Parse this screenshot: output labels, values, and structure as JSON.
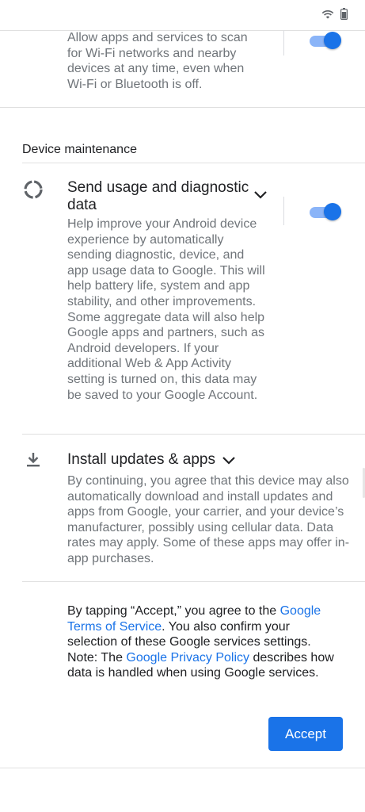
{
  "wifi_scan": {
    "description": "Allow apps and services to scan for Wi-Fi networks and nearby devices at any time, even when Wi-Fi or Bluetooth is off.",
    "toggle_on": true
  },
  "device_maintenance": {
    "header": "Device maintenance",
    "usage": {
      "icon": "progress-circle-icon",
      "title": "Send usage and diagnostic data",
      "description": "Help improve your Android device experience by automatically sending diagnostic, device, and app usage data to Google. This will help battery life, system and app stability, and other improvements. Some aggregate data will also help Google apps and partners, such as Android developers. If your additional Web & App Activity setting is turned on, this data may be saved to your Google Account.",
      "toggle_on": true
    },
    "updates": {
      "icon": "download-icon",
      "title": "Install updates & apps",
      "description": "By continuing, you agree that this device may also automatically download and install updates and apps from Google, your carrier, and your device’s manufacturer, possibly using cellular data. Data rates may apply. Some of these apps may offer in-app purchases."
    }
  },
  "consent": {
    "part1": "By tapping “Accept,” you agree to the ",
    "tos_link": "Google Terms of Service",
    "part2": ". You also confirm your selection of these Google services settings. Note: The ",
    "privacy_link": "Google Privacy Policy",
    "part3": " describes how data is handled when using Google services."
  },
  "accept_label": "Accept",
  "colors": {
    "accent": "#1a73e8",
    "toggle_track": "#8ab4f8"
  }
}
